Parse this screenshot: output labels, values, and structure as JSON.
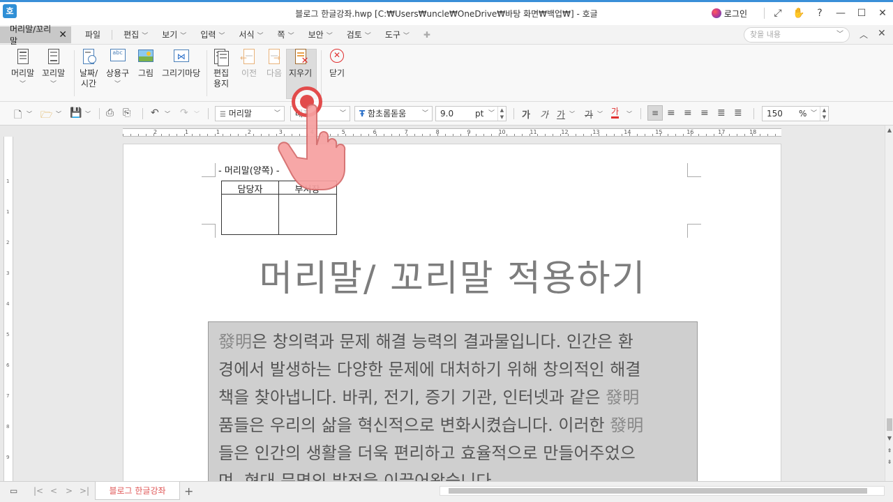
{
  "window": {
    "app_logo": "호",
    "title": "블로그 한글강좌.hwp [C:₩Users₩uncle₩OneDrive₩바탕 화면₩백업₩] - 호글",
    "login_label": "로그인",
    "controls": [
      "⤢",
      "✋",
      "?",
      "—",
      "☐",
      "✕"
    ]
  },
  "menubar": {
    "context_tab": "머리말/꼬리말",
    "context_tab_close": "✕",
    "file": "파일",
    "items": [
      {
        "label": "편집"
      },
      {
        "label": "보기"
      },
      {
        "label": "입력"
      },
      {
        "label": "서식"
      },
      {
        "label": "쪽"
      },
      {
        "label": "보안"
      },
      {
        "label": "검토"
      },
      {
        "label": "도구"
      }
    ],
    "find_placeholder": "찾을 내용"
  },
  "ribbon": {
    "buttons": {
      "header": "머리말",
      "footer": "꼬리말",
      "datetime_1": "날짜/",
      "datetime_2": "시간",
      "autotext": "상용구",
      "picture": "그림",
      "drawing": "그리기마당",
      "edit_paper_1": "편집",
      "edit_paper_2": "용지",
      "prev": "이전",
      "next": "다음",
      "delete": "지우기",
      "close": "닫기"
    }
  },
  "toolbar": {
    "style": "머리말",
    "lang": "대표",
    "font": "함초롬돋움",
    "size": "9.0",
    "size_unit": "pt",
    "zoom": "150",
    "zoom_unit": "%",
    "format_glyphs": [
      "가",
      "가",
      "가",
      "가",
      "가"
    ]
  },
  "ruler": {
    "labels": [
      "2",
      "1",
      "1",
      "2",
      "3",
      "4",
      "5",
      "6",
      "7",
      "8",
      "9",
      "10",
      "11",
      "12",
      "13",
      "14",
      "15",
      "16",
      "17",
      "18"
    ]
  },
  "vruler": {
    "labels": [
      "1",
      "1",
      "2",
      "3",
      "4",
      "5",
      "6",
      "7",
      "8",
      "9"
    ]
  },
  "document": {
    "header_label": "- 머리말(양쪽) -",
    "table_headers": [
      "담당자",
      "부서장"
    ],
    "title": "머리말/ 꼬리말 적용하기",
    "body_lines": [
      [
        "發明",
        "은 창의력과 문제 해결 능력의 결과물입니다. 인간은 환"
      ],
      [
        "",
        "경에서 발생하는 다양한 문제에 대처하기 위해 창의적인 해결"
      ],
      [
        "",
        "책을 찾아냅니다. 바퀴, 전기, 증기 기관, 인터넷과 같은 ",
        "發明"
      ],
      [
        "",
        "품들은 우리의 삶을 혁신적으로 변화시켰습니다. 이러한 ",
        "發明"
      ],
      [
        "",
        "들은 인간의 생활을 더욱 편리하고 효율적으로 만들어주었으"
      ],
      [
        "",
        "며, 현대 문명의 발전을 이끌어왔습니다."
      ]
    ]
  },
  "statusbar": {
    "doc_tab": "블로그 한글강좌",
    "add_tab": "+"
  },
  "colors": {
    "accent": "#3a8fd8",
    "touch_red": "#e24b4b",
    "tab_text": "#e05656"
  }
}
